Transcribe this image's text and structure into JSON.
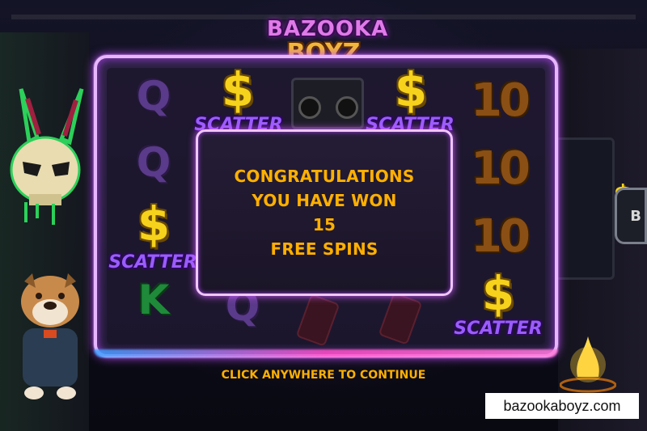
{
  "logo": {
    "line1": "BAZOOKA",
    "line2": "BOYZ"
  },
  "reels": {
    "col1": [
      "Q",
      "Q",
      "$",
      "K"
    ],
    "col1_scatter": "SCATTER",
    "col2_top_scatter": "SCATTER",
    "col4_top_scatter": "SCATTER",
    "col5": [
      "10",
      "10",
      "10",
      "$"
    ],
    "col5_scatter": "SCATTER",
    "col3_row4": "Q"
  },
  "dialog": {
    "line1": "CONGRATULATIONS",
    "line2": "YOU HAVE WON",
    "line3": "15",
    "line4": "FREE SPINS"
  },
  "continue_label": "CLICK ANYWHERE TO CONTINUE",
  "side_button_label": "B",
  "watermark": "bazookaboyz.com",
  "colors": {
    "accent_gold": "#ffb000",
    "frame_neon": "#e8b6ff",
    "dollar_yellow": "#f6d21c",
    "scatter_purple": "#9a5cff"
  }
}
